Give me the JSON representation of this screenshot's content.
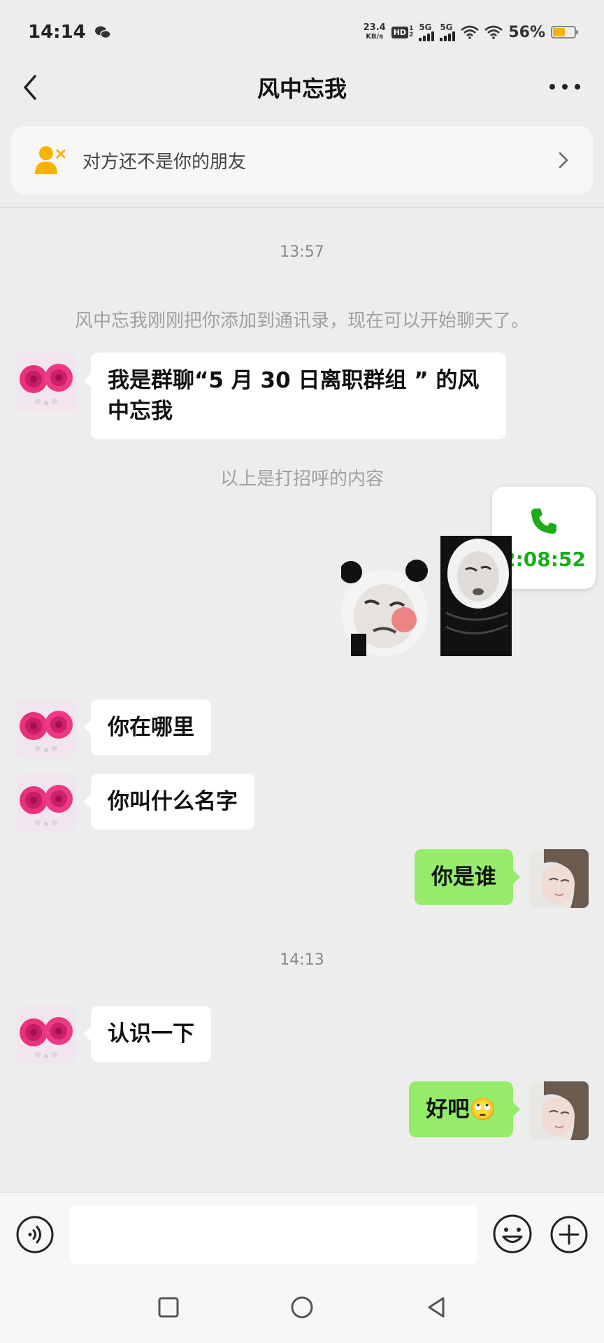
{
  "status_bar": {
    "time": "14:14",
    "net_speed_value": "23.4",
    "net_speed_unit": "KB/s",
    "hd_label": "HD",
    "signal1_label": "5G",
    "signal2_label": "5G",
    "battery_percent": "56%",
    "battery_level": 0.56,
    "icons": [
      "wechat-notification-icon",
      "hd-icon",
      "signal-icon",
      "wifi-icon",
      "battery-icon"
    ]
  },
  "header": {
    "title": "风中忘我"
  },
  "friend_notice": {
    "text": "对方还不是你的朋友"
  },
  "chat": {
    "time_1": "13:57",
    "system_added": "风中忘我刚刚把你添加到通讯录，现在可以开始聊天了。",
    "msg_greeting_line1": "我是群聊“5 月 30 日离职群组 ” 的风",
    "msg_greeting_line2": "中忘我",
    "system_greeting_end": "以上是打招呼的内容",
    "call_duration": "2:08:52",
    "msg_where": "你在哪里",
    "msg_name": "你叫什么名字",
    "msg_who": "你是谁",
    "time_2": "14:13",
    "msg_meet": "认识一下",
    "msg_ok": "好吧",
    "msg_ok_emoji": "🙄"
  },
  "colors": {
    "background": "#ededed",
    "my_bubble": "#95ec69",
    "their_bubble": "#ffffff",
    "call_green": "#1aad19",
    "battery": "#f5b400"
  }
}
